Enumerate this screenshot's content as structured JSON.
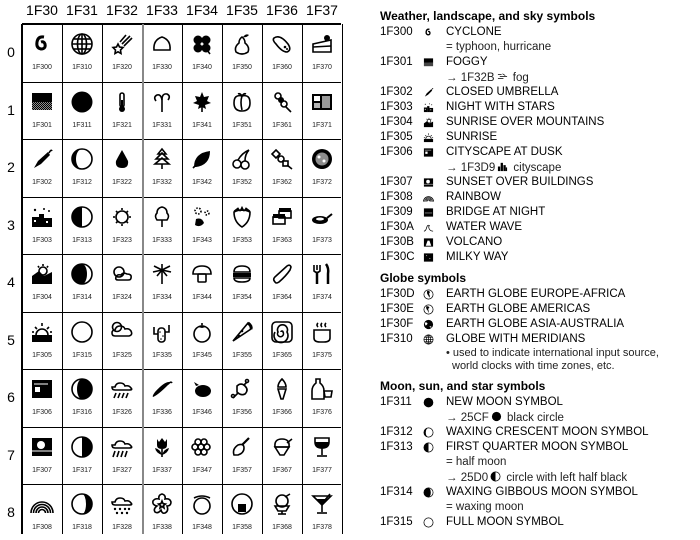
{
  "grid": {
    "column_headers": [
      "1F30",
      "1F31",
      "1F32",
      "1F33",
      "1F34",
      "1F35",
      "1F36",
      "1F37"
    ],
    "row_headers": [
      "0",
      "1",
      "2",
      "3",
      "4",
      "5",
      "6",
      "7",
      "8"
    ],
    "cells": [
      [
        "1F300",
        "1F310",
        "1F320",
        "1F330",
        "1F340",
        "1F350",
        "1F360",
        "1F370"
      ],
      [
        "1F301",
        "1F311",
        "1F321",
        "1F331",
        "1F341",
        "1F351",
        "1F361",
        "1F371"
      ],
      [
        "1F302",
        "1F312",
        "1F322",
        "1F332",
        "1F342",
        "1F352",
        "1F362",
        "1F372"
      ],
      [
        "1F303",
        "1F313",
        "1F323",
        "1F333",
        "1F343",
        "1F353",
        "1F363",
        "1F373"
      ],
      [
        "1F304",
        "1F314",
        "1F324",
        "1F334",
        "1F344",
        "1F354",
        "1F364",
        "1F374"
      ],
      [
        "1F305",
        "1F315",
        "1F325",
        "1F335",
        "1F345",
        "1F355",
        "1F365",
        "1F375"
      ],
      [
        "1F306",
        "1F316",
        "1F326",
        "1F336",
        "1F346",
        "1F356",
        "1F366",
        "1F376"
      ],
      [
        "1F307",
        "1F317",
        "1F327",
        "1F337",
        "1F347",
        "1F357",
        "1F367",
        "1F377"
      ],
      [
        "1F308",
        "1F318",
        "1F328",
        "1F338",
        "1F348",
        "1F358",
        "1F368",
        "1F378"
      ]
    ],
    "icons": [
      [
        "cyclone",
        "globe-meridians",
        "shooting-star",
        "chestnut",
        "four-leaf-clover",
        "pear",
        "roasted-sweet-potato",
        "shortcake"
      ],
      [
        "foggy",
        "new-moon",
        "thermometer",
        "seedling-sprout",
        "maple-leaf",
        "peach",
        "dango",
        "bento-box"
      ],
      [
        "closed-umbrella",
        "waxing-crescent-moon",
        "droplet",
        "evergreen-tree",
        "fallen-leaf",
        "cherries",
        "oden",
        "ramen-bowl"
      ],
      [
        "night-with-stars",
        "first-quarter-moon",
        "sun",
        "deciduous-tree",
        "leaf-fluttering",
        "strawberry",
        "sushi",
        "cooking-pan"
      ],
      [
        "sunrise-mountains",
        "waxing-gibbous-moon",
        "sun-behind-cloud",
        "palm-tree",
        "mushroom",
        "hamburger",
        "eggplant-cucumber",
        "fork-and-knife"
      ],
      [
        "sunrise",
        "full-moon",
        "cloud-with-sun",
        "cactus",
        "tomato",
        "pizza",
        "fish-cake",
        "hot-beverage"
      ],
      [
        "cityscape-dusk",
        "waning-gibbous-moon",
        "cloud-with-rain",
        "hot-pepper",
        "eggplant",
        "meat-on-bone",
        "soft-ice-cream",
        "sake"
      ],
      [
        "sunset-buildings",
        "last-quarter-moon",
        "cloud-rain-heavy",
        "tulip",
        "grapes",
        "poultry-leg",
        "shaved-ice",
        "wine-glass"
      ],
      [
        "rainbow",
        "waning-crescent-moon",
        "cloud-with-snow",
        "blossom",
        "melon",
        "rice-ball",
        "ice-cream",
        "cocktail-glass"
      ]
    ]
  },
  "panel": {
    "sections": [
      {
        "title": "Weather, landscape, and sky symbols",
        "entries": [
          {
            "code": "1F300",
            "icon": "cyclone",
            "name": "CYCLONE",
            "notes": [
              "= typhoon, hurricane"
            ]
          },
          {
            "code": "1F301",
            "icon": "foggy",
            "name": "FOGGY",
            "xref": {
              "arrow": "→",
              "code": "1F32B",
              "icon": "fog",
              "text": "fog"
            }
          },
          {
            "code": "1F302",
            "icon": "closed-umbrella",
            "name": "CLOSED UMBRELLA"
          },
          {
            "code": "1F303",
            "icon": "night-with-stars",
            "name": "NIGHT WITH STARS"
          },
          {
            "code": "1F304",
            "icon": "sunrise-mountains",
            "name": "SUNRISE OVER MOUNTAINS"
          },
          {
            "code": "1F305",
            "icon": "sunrise",
            "name": "SUNRISE"
          },
          {
            "code": "1F306",
            "icon": "cityscape-dusk",
            "name": "CITYSCAPE AT DUSK",
            "xref": {
              "arrow": "→",
              "code": "1F3D9",
              "icon": "cityscape",
              "text": "cityscape"
            }
          },
          {
            "code": "1F307",
            "icon": "sunset-buildings",
            "name": "SUNSET OVER BUILDINGS"
          },
          {
            "code": "1F308",
            "icon": "rainbow",
            "name": "RAINBOW"
          },
          {
            "code": "1F309",
            "icon": "bridge-at-night",
            "name": "BRIDGE AT NIGHT"
          },
          {
            "code": "1F30A",
            "icon": "water-wave",
            "name": "WATER WAVE"
          },
          {
            "code": "1F30B",
            "icon": "volcano",
            "name": "VOLCANO"
          },
          {
            "code": "1F30C",
            "icon": "milky-way",
            "name": "MILKY WAY"
          }
        ]
      },
      {
        "title": "Globe symbols",
        "entries": [
          {
            "code": "1F30D",
            "icon": "globe-europe-africa",
            "name": "EARTH GLOBE EUROPE-AFRICA"
          },
          {
            "code": "1F30E",
            "icon": "globe-americas",
            "name": "EARTH GLOBE AMERICAS"
          },
          {
            "code": "1F30F",
            "icon": "globe-asia-australia",
            "name": "EARTH GLOBE ASIA-AUSTRALIA"
          },
          {
            "code": "1F310",
            "icon": "globe-meridians",
            "name": "GLOBE WITH MERIDIANS",
            "bullets": [
              "• used to indicate international input source,",
              "world clocks with time zones, etc."
            ]
          }
        ]
      },
      {
        "title": "Moon, sun, and star symbols",
        "entries": [
          {
            "code": "1F311",
            "icon": "new-moon",
            "name": "NEW MOON SYMBOL",
            "xref": {
              "arrow": "→",
              "code": "25CF",
              "icon": "black-circle",
              "text": "black circle"
            }
          },
          {
            "code": "1F312",
            "icon": "waxing-crescent-moon",
            "name": "WAXING CRESCENT MOON SYMBOL"
          },
          {
            "code": "1F313",
            "icon": "first-quarter-moon",
            "name": "FIRST QUARTER MOON SYMBOL",
            "notes": [
              "= half moon"
            ],
            "xref": {
              "arrow": "→",
              "code": "25D0",
              "icon": "circle-left-half-black",
              "text": "circle with left half black"
            }
          },
          {
            "code": "1F314",
            "icon": "waxing-gibbous-moon",
            "name": "WAXING GIBBOUS MOON SYMBOL",
            "notes": [
              "= waxing moon"
            ]
          },
          {
            "code": "1F315",
            "icon": "full-moon",
            "name": "FULL MOON SYMBOL"
          }
        ]
      }
    ]
  }
}
